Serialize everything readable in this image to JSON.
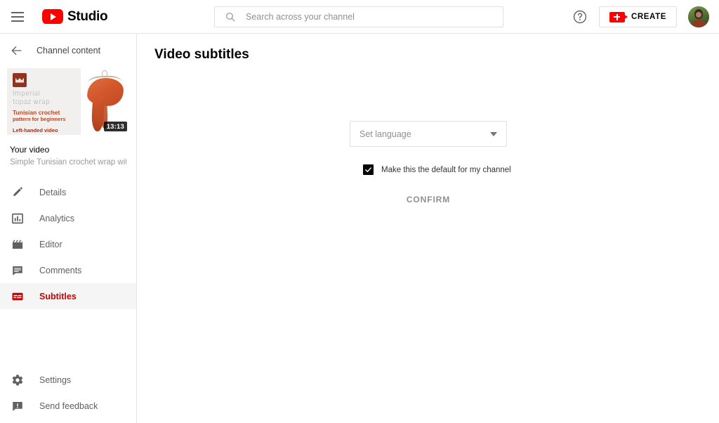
{
  "header": {
    "menu_icon": "hamburger-icon",
    "brand": "Studio",
    "logo_icon": "youtube-logo-icon",
    "search": {
      "placeholder": "Search across your channel",
      "value": "",
      "icon": "search-icon"
    },
    "help_icon": "help-circle-icon",
    "create_label": "CREATE",
    "create_icon": "video-camera-plus-icon",
    "avatar": "channel-avatar",
    "accent_color": "#ff0000"
  },
  "sidebar": {
    "back_label": "Channel content",
    "back_icon": "arrow-left-icon",
    "thumbnail": {
      "brand_mark": "crown-logo-icon",
      "title_line1": "Imperial",
      "title_line2": "topaz wrap",
      "sub_line1": "Tunisian crochet",
      "sub_line2": "pattern for beginners",
      "sub_line3": "Left-handed video",
      "duration": "13:13",
      "title_color": "#9b9b9b",
      "accent_color": "#c8401d"
    },
    "video": {
      "label": "Your video",
      "description": "Simple Tunisian crochet wrap with g..."
    },
    "items": [
      {
        "label": "Details",
        "icon": "pencil-icon",
        "active": false
      },
      {
        "label": "Analytics",
        "icon": "bar-chart-icon",
        "active": false
      },
      {
        "label": "Editor",
        "icon": "clapperboard-icon",
        "active": false
      },
      {
        "label": "Comments",
        "icon": "comment-icon",
        "active": false
      },
      {
        "label": "Subtitles",
        "icon": "subtitles-icon",
        "active": true
      }
    ],
    "bottom_items": [
      {
        "label": "Settings",
        "icon": "gear-icon"
      },
      {
        "label": "Send feedback",
        "icon": "feedback-icon"
      }
    ],
    "active_color": "#cc0000",
    "active_bg": "#f5f5f5"
  },
  "main": {
    "page_title": "Video subtitles",
    "language_select": {
      "value": "Set language",
      "caret_icon": "chevron-down-icon"
    },
    "default_checkbox": {
      "label": "Make this the default for my channel",
      "checked": true
    },
    "confirm_label": "CONFIRM"
  }
}
